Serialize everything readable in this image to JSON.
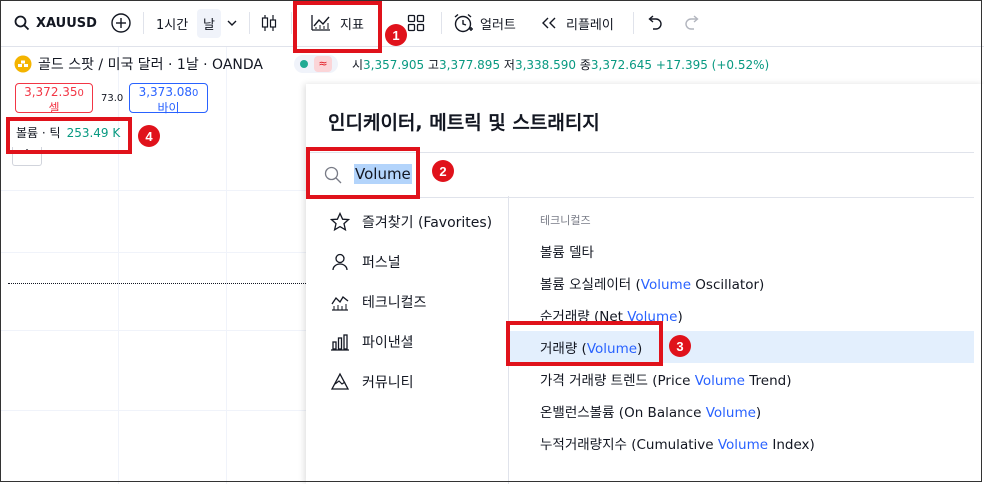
{
  "toolbar": {
    "symbol": "XAUUSD",
    "interval": "1시간",
    "day": "날",
    "indicators_label": "지표",
    "alert_label": "얼러트",
    "replay_label": "리플레이"
  },
  "info": {
    "title": "골드 스팟 / 미국 달러 · 1날 · OANDA",
    "ohlc": [
      {
        "label": "시",
        "value": "3,357.905"
      },
      {
        "label": "고",
        "value": "3,377.895"
      },
      {
        "label": "저",
        "value": "3,338.590"
      },
      {
        "label": "종",
        "value": "3,372.645"
      }
    ],
    "change": "+17.395 (+0.52%)"
  },
  "trade": {
    "sell_price": "3,372.35",
    "sell_sup": "0",
    "sell_label": "셀",
    "spread": "73.0",
    "buy_price": "3,373.08",
    "buy_sup": "0",
    "buy_label": "바이"
  },
  "volume_label": {
    "name": "볼륨 · 틱",
    "value": "253.49 K"
  },
  "dialog": {
    "title": "인디케이터, 메트릭 및 스트래티지",
    "search_value": "Volume",
    "categories": [
      {
        "label": "즐겨찾기 (Favorites)",
        "icon": "star-icon"
      },
      {
        "label": "퍼스널",
        "icon": "person-icon"
      },
      {
        "label": "테크니컬즈",
        "icon": "technicals-icon"
      },
      {
        "label": "파이낸셜",
        "icon": "financials-icon"
      },
      {
        "label": "커뮤니티",
        "icon": "community-icon"
      }
    ],
    "section_label": "테크니컬즈",
    "items": [
      {
        "pre": "볼륨 델타",
        "kw": "",
        "post": ""
      },
      {
        "pre": "볼륨 오실레이터 (",
        "kw": "Volume",
        "post": " Oscillator)"
      },
      {
        "pre": "순거래량 (Net ",
        "kw": "Volume",
        "post": ")"
      },
      {
        "pre": "거래량 (",
        "kw": "Volume",
        "post": ")"
      },
      {
        "pre": "가격 거래량 트렌드 (Price ",
        "kw": "Volume",
        "post": " Trend)"
      },
      {
        "pre": "온밸런스볼륨 (On Balance ",
        "kw": "Volume",
        "post": ")"
      },
      {
        "pre": "누적거래량지수 (Cumulative ",
        "kw": "Volume",
        "post": " Index)"
      }
    ]
  },
  "annotations": {
    "badge1": "1",
    "badge2": "2",
    "badge3": "3",
    "badge4": "4"
  },
  "colors": {
    "highlight": "#e0121b",
    "keyword": "#2962ff",
    "up": "#089981",
    "sell": "#f23645",
    "buy": "#2962ff",
    "selected_row": "#e3effd"
  }
}
